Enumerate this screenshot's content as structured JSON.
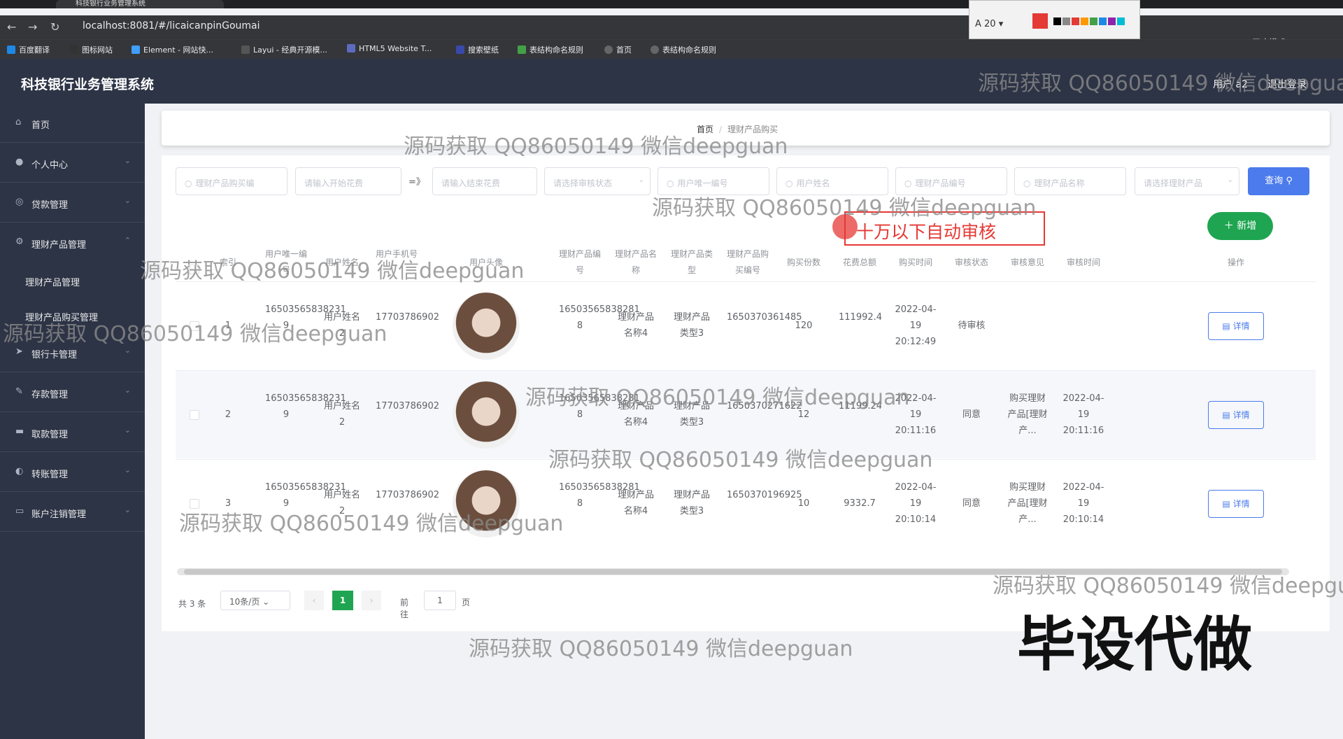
{
  "browser": {
    "tab_title": "科技银行业务管理系统",
    "url": "localhost:8081/#/licaicanpinGoumai",
    "bookmarks": [
      "百度翻译",
      "图标网站",
      "Element - 网站快...",
      "Layui - 经典开源模...",
      "HTML5 Website T...",
      "搜索壁纸",
      "表结构命名规则",
      "首页",
      "表结构命名规则"
    ],
    "brush_size": "20",
    "incognito_label": "无痕模式"
  },
  "header": {
    "title": "科技银行业务管理系统",
    "user": "用户 a2",
    "logout": "退出登录"
  },
  "sidebar": {
    "items": [
      {
        "label": "首页",
        "icon": "home-icon"
      },
      {
        "label": "个人中心",
        "icon": "user-icon"
      },
      {
        "label": "贷款管理",
        "icon": "loan-icon"
      },
      {
        "label": "理财产品管理",
        "icon": "finance-icon"
      },
      {
        "label": "银行卡管理",
        "icon": "card-icon"
      },
      {
        "label": "存款管理",
        "icon": "deposit-icon"
      },
      {
        "label": "取款管理",
        "icon": "withdraw-icon"
      },
      {
        "label": "转账管理",
        "icon": "transfer-icon"
      },
      {
        "label": "账户注销管理",
        "icon": "account-icon"
      }
    ],
    "sub_items": [
      "理财产品管理",
      "理财产品购买管理"
    ]
  },
  "breadcrumb": {
    "home": "首页",
    "current": "理财产品购买"
  },
  "search": {
    "placeholders": [
      "理财产品购买编",
      "请输入开始花费",
      "请输入结束花费",
      "请选择审核状态",
      "用户唯一编号",
      "用户姓名",
      "理财产品编号",
      "理财产品名称",
      "请选择理财产品"
    ],
    "separator": "=》",
    "button": "查询"
  },
  "add_button": "新增",
  "annotation": "十万以下自动审核",
  "table": {
    "headers": [
      "索引",
      "用户唯一编号",
      "用户姓名",
      "用户手机号",
      "用户头像",
      "理财产品编号",
      "理财产品名称",
      "理财产品类型",
      "理财产品购买编号",
      "购买份数",
      "花费总额",
      "购买时间",
      "审核状态",
      "审核意见",
      "审核时间",
      "操作"
    ],
    "rows": [
      {
        "idx": "1",
        "uid": "16503565838231 9",
        "name": "用户姓名 2",
        "phone": "17703786902",
        "pid": "16503565838281 8",
        "pname": "理财产品名称4",
        "ptype": "理财产品类型3",
        "buyid": "1650370361485",
        "qty": "120",
        "total": "111992.4",
        "time": "2022-04-19 20:12:49",
        "status": "待审核",
        "opinion": "",
        "audit_time": "",
        "op": "详情"
      },
      {
        "idx": "2",
        "uid": "16503565838231 9",
        "name": "用户姓名 2",
        "phone": "17703786902",
        "pid": "16503565838281 8",
        "pname": "理财产品名称4",
        "ptype": "理财产品类型3",
        "buyid": "1650370271622",
        "qty": "12",
        "total": "11199.24",
        "time": "2022-04-19 20:11:16",
        "status": "同意",
        "opinion": "购买理财产品[理财产...",
        "audit_time": "2022-04-19 20:11:16",
        "op": "详情"
      },
      {
        "idx": "3",
        "uid": "16503565838231 9",
        "name": "用户姓名 2",
        "phone": "17703786902",
        "pid": "16503565838281 8",
        "pname": "理财产品名称4",
        "ptype": "理财产品类型3",
        "buyid": "1650370196925",
        "qty": "10",
        "total": "9332.7",
        "time": "2022-04-19 20:10:14",
        "status": "同意",
        "opinion": "购买理财产品[理财产...",
        "audit_time": "2022-04-19 20:10:14",
        "op": "详情"
      }
    ]
  },
  "pagination": {
    "total": "共 3 条",
    "size": "10条/页",
    "current": "1",
    "goto": "前往",
    "input": "1",
    "unit": "页"
  },
  "watermark": "源码获取 QQ86050149 微信deepguan",
  "big_watermark": "毕设代做"
}
